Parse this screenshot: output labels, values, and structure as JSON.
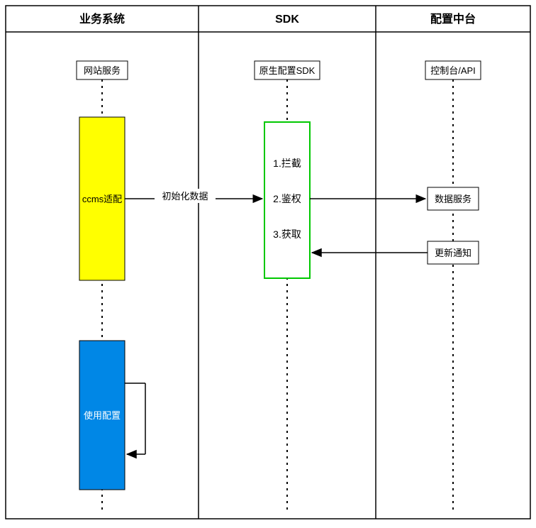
{
  "lanes": {
    "biz": {
      "header": "业务系统",
      "participant": "网站服务"
    },
    "sdk": {
      "header": "SDK",
      "participant": "原生配置SDK"
    },
    "cfg": {
      "header": "配置中台",
      "participant": "控制台/API"
    }
  },
  "nodes": {
    "ccms": "ccms适配",
    "steps": {
      "s1": "1.拦截",
      "s2": "2.鉴权",
      "s3": "3.获取"
    },
    "dataService": "数据服务",
    "updateNotify": "更新通知",
    "useConfig": "使用配置"
  },
  "edges": {
    "initData": "初始化数据"
  }
}
